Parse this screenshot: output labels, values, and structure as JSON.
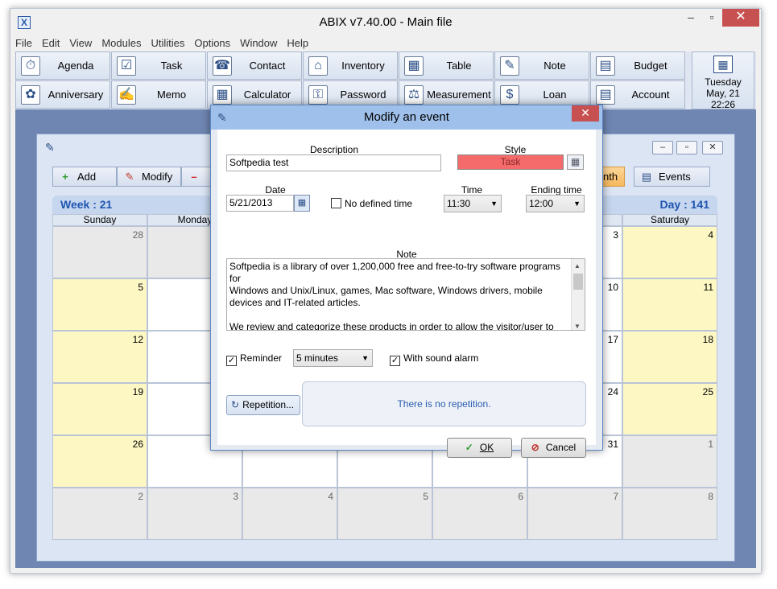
{
  "window": {
    "title": "ABIX v7.40.00  -  Main file",
    "app_icon": "X",
    "min": "–",
    "max": "▫",
    "close": "✕"
  },
  "menu": [
    "File",
    "Edit",
    "View",
    "Modules",
    "Utilities",
    "Options",
    "Window",
    "Help"
  ],
  "toolbar": {
    "row1": [
      {
        "label": "Agenda",
        "icon": "⏱"
      },
      {
        "label": "Task",
        "icon": "☑"
      },
      {
        "label": "Contact",
        "icon": "☎"
      },
      {
        "label": "Inventory",
        "icon": "⌂"
      },
      {
        "label": "Table",
        "icon": "▦"
      },
      {
        "label": "Note",
        "icon": "✎"
      },
      {
        "label": "Budget",
        "icon": "▤"
      }
    ],
    "row2": [
      {
        "label": "Anniversary",
        "icon": "✿"
      },
      {
        "label": "Memo",
        "icon": "✍"
      },
      {
        "label": "Calculator",
        "icon": "▦"
      },
      {
        "label": "Password",
        "icon": "⚿"
      },
      {
        "label": "Measurement",
        "icon": "⚖"
      },
      {
        "label": "Loan",
        "icon": "$"
      },
      {
        "label": "Account",
        "icon": "▤"
      }
    ],
    "clock": {
      "day": "Tuesday",
      "date": "May, 21",
      "time": "22:26",
      "icon": "▦"
    }
  },
  "calendar": {
    "buttons": {
      "add": "Add",
      "modify": "Modify",
      "month": "nth",
      "events": "Events"
    },
    "week_label": "Week : 21",
    "day_label": "Day : 141",
    "days": [
      "Sunday",
      "Monday",
      "",
      "",
      "",
      "",
      "Saturday"
    ],
    "rows": [
      [
        "28",
        "",
        "",
        "",
        "",
        "3",
        "4"
      ],
      [
        "5",
        "",
        "",
        "",
        "",
        "10",
        "11"
      ],
      [
        "12",
        "",
        "",
        "",
        "",
        "17",
        "18"
      ],
      [
        "19",
        "",
        "",
        "",
        "",
        "24",
        "25"
      ],
      [
        "26",
        "",
        "",
        "",
        "",
        "31",
        "1"
      ],
      [
        "2",
        "3",
        "4",
        "5",
        "6",
        "7",
        "8"
      ]
    ]
  },
  "dialog": {
    "title": "Modify an event",
    "close": "✕",
    "description_label": "Description",
    "description_value": "Softpedia test",
    "style_label": "Style",
    "style_value": "Task",
    "style_color": "#f56b6b",
    "date_label": "Date",
    "date_value": "5/21/2013",
    "no_time_label": "No defined time",
    "time_label": "Time",
    "time_value": "11:30",
    "end_label": "Ending time",
    "end_value": "12:00",
    "note_label": "Note",
    "note_lines": [
      "Softpedia is a library of over 1,200,000 free and free-to-try software programs for",
      "Windows and Unix/Linux, games, Mac software, Windows drivers, mobile",
      "devices and IT-related articles.",
      "",
      "We review and categorize these products in order to allow the visitor/user to"
    ],
    "reminder_label": "Reminder",
    "reminder_value": "5 minutes",
    "sound_label": "With sound alarm",
    "repetition_button": "Repetition...",
    "repetition_text": "There is no repetition.",
    "ok": "OK",
    "cancel": "Cancel"
  }
}
